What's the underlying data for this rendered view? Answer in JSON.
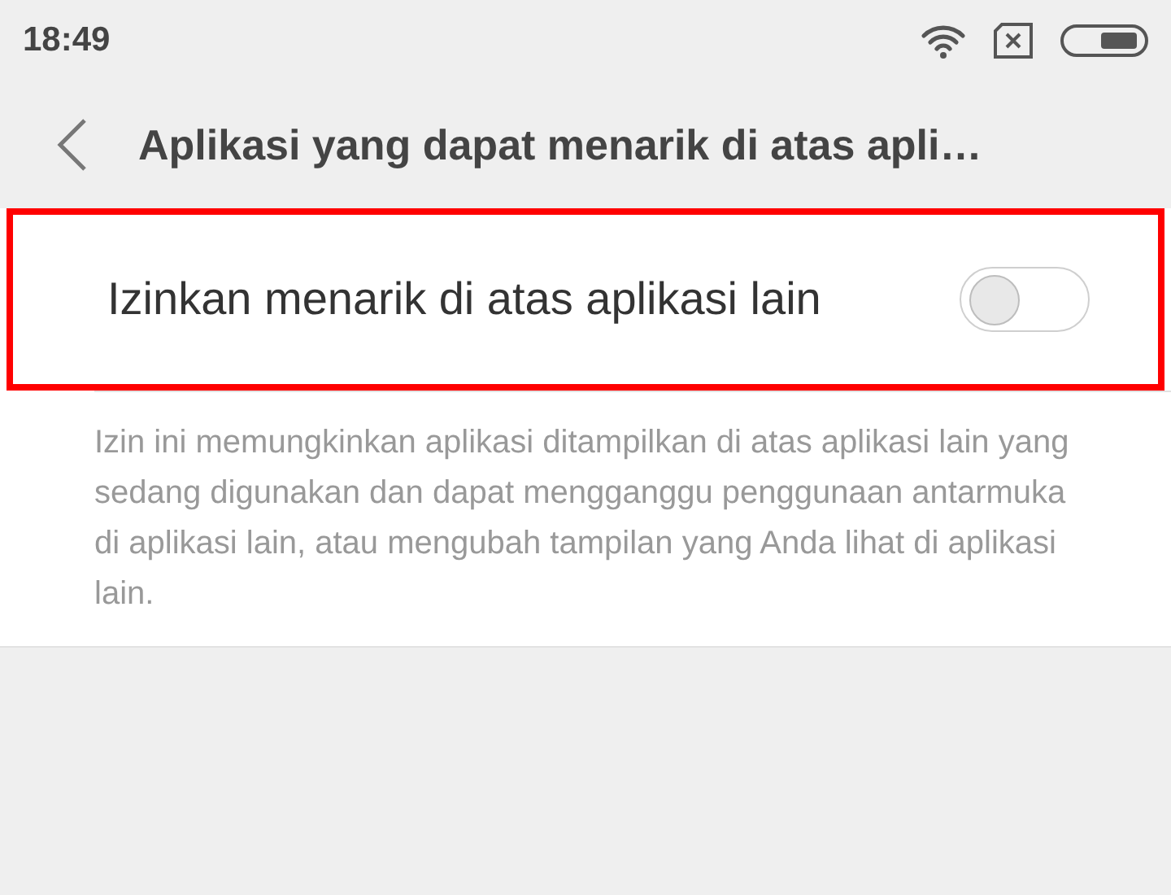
{
  "status_bar": {
    "time": "18:49"
  },
  "header": {
    "title": "Aplikasi yang dapat menarik di atas apli…"
  },
  "setting": {
    "label": "Izinkan menarik di atas aplikasi lain",
    "on": false,
    "highlighted": true
  },
  "description": "Izin ini memungkinkan aplikasi ditampilkan di atas aplikasi lain yang sedang digunakan dan dapat mengganggu penggunaan antarmuka di aplikasi lain, atau mengubah tampilan yang Anda lihat di aplikasi lain."
}
